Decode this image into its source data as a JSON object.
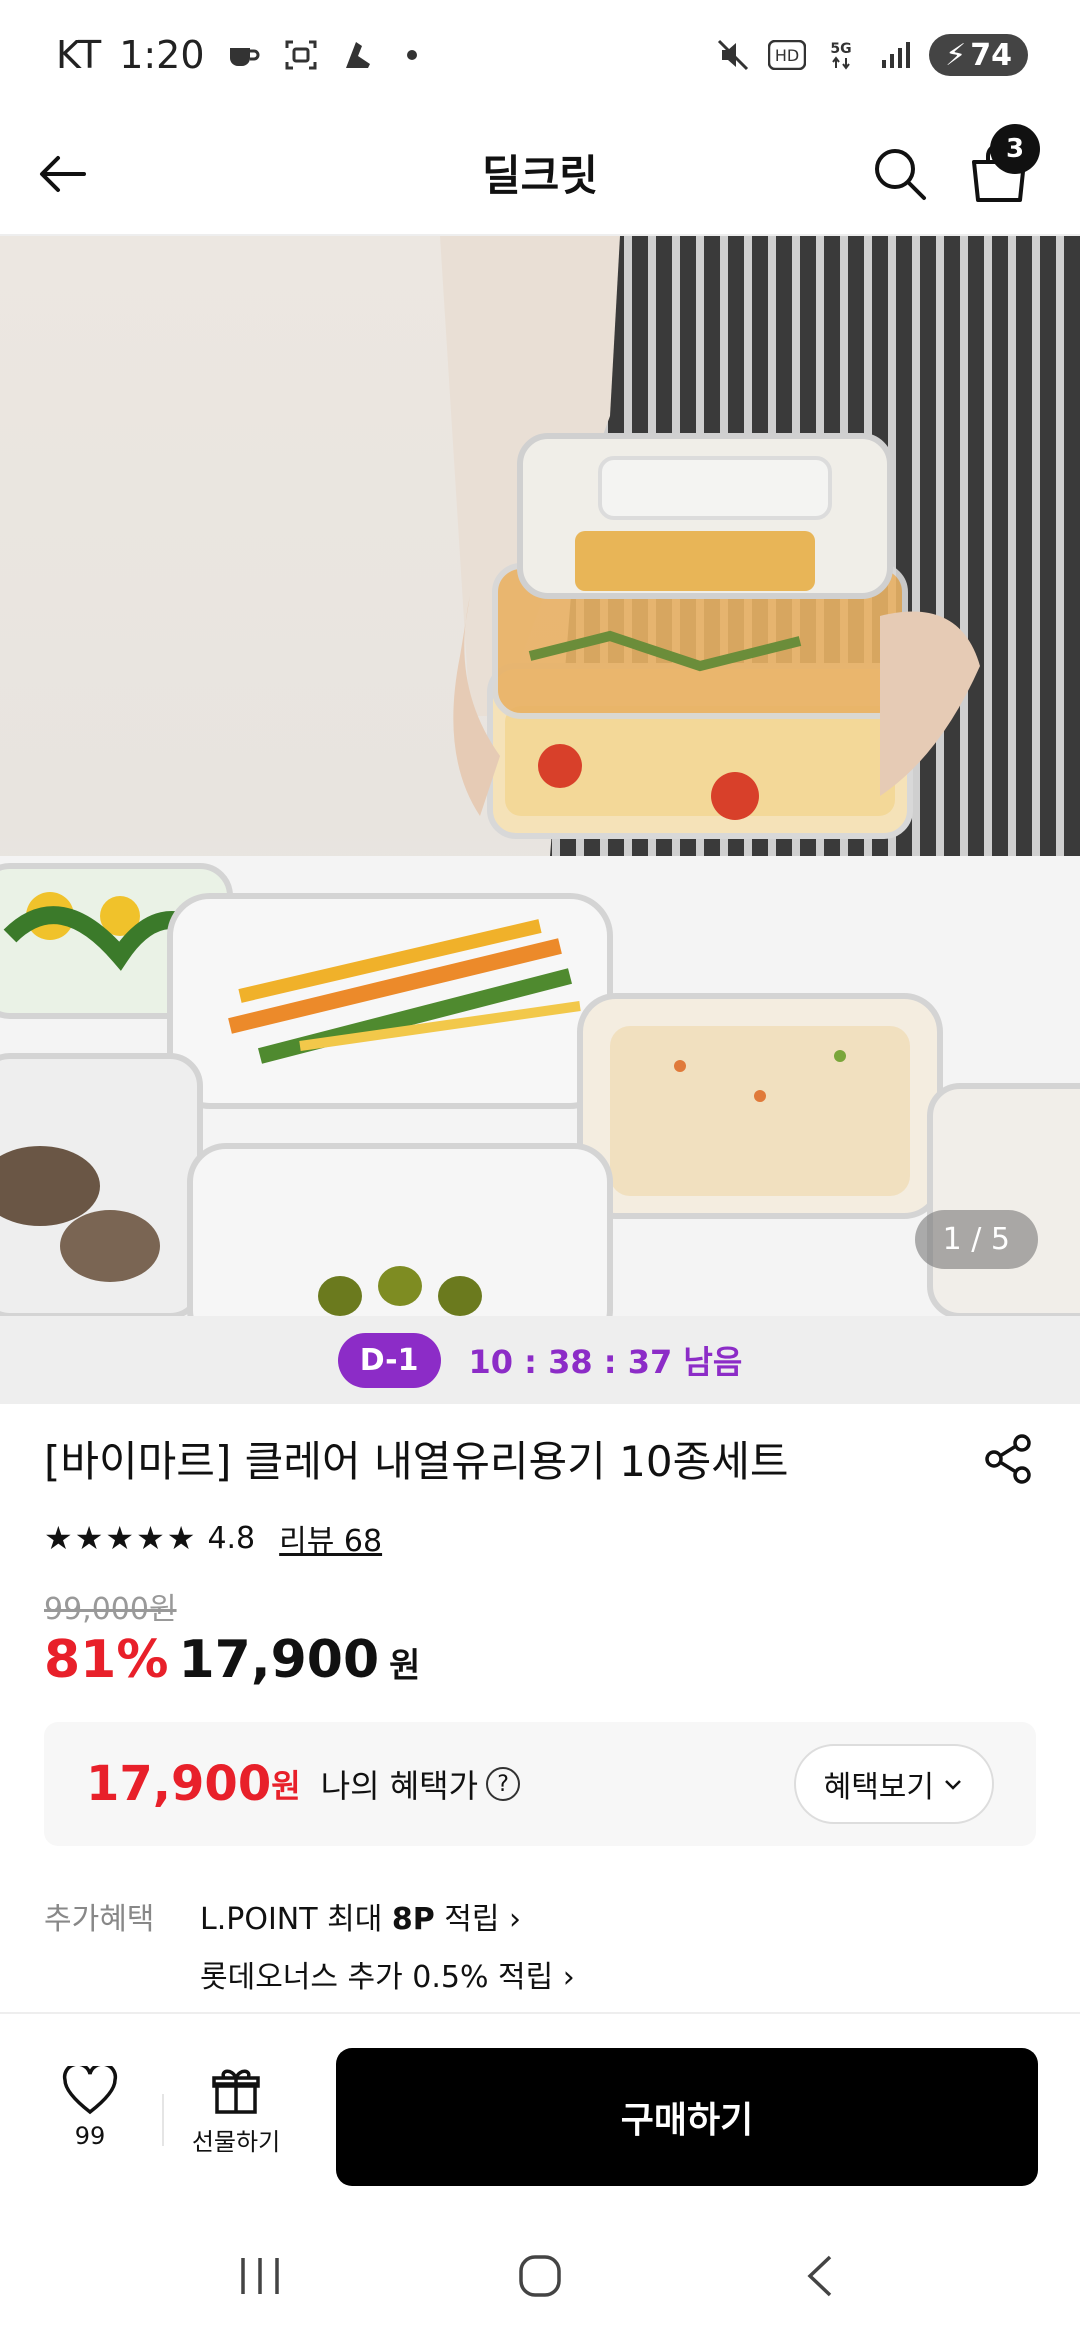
{
  "status": {
    "carrier": "KT",
    "time": "1:20",
    "battery": "74",
    "icons": [
      "coffee-icon",
      "screenshot-icon",
      "shoe-icon",
      "mute-icon",
      "hd-icon",
      "5g-icon",
      "signal-icon"
    ]
  },
  "header": {
    "title": "딜크릿",
    "cart_count": "3"
  },
  "gallery": {
    "counter": "1 / 5"
  },
  "timer": {
    "dday": "D-1",
    "remaining": "10 : 38 : 37  남음"
  },
  "product": {
    "title": "[바이마르] 클레어 내열유리용기 10종세트",
    "stars": "★★★★★",
    "rating": "4.8",
    "review_label": "리뷰 68",
    "original_price": "99,000원",
    "discount": "81%",
    "price": "17,900",
    "price_unit": "원"
  },
  "benefit": {
    "price": "17,900",
    "unit": "원",
    "label": "나의 혜택가",
    "help": "?",
    "button": "혜택보기"
  },
  "extra": {
    "label": "추가혜택",
    "line1_prefix": "L.POINT 최대 ",
    "line1_bold": "8P",
    "line1_suffix": " 적립 ›",
    "line2": "롯데오너스 추가 0.5% 적립 ›"
  },
  "actions": {
    "wish_count": "99",
    "gift_label": "선물하기",
    "buy_label": "구매하기"
  },
  "colors": {
    "accent_red": "#e8202a",
    "timer_purple": "#8c2cc7"
  }
}
